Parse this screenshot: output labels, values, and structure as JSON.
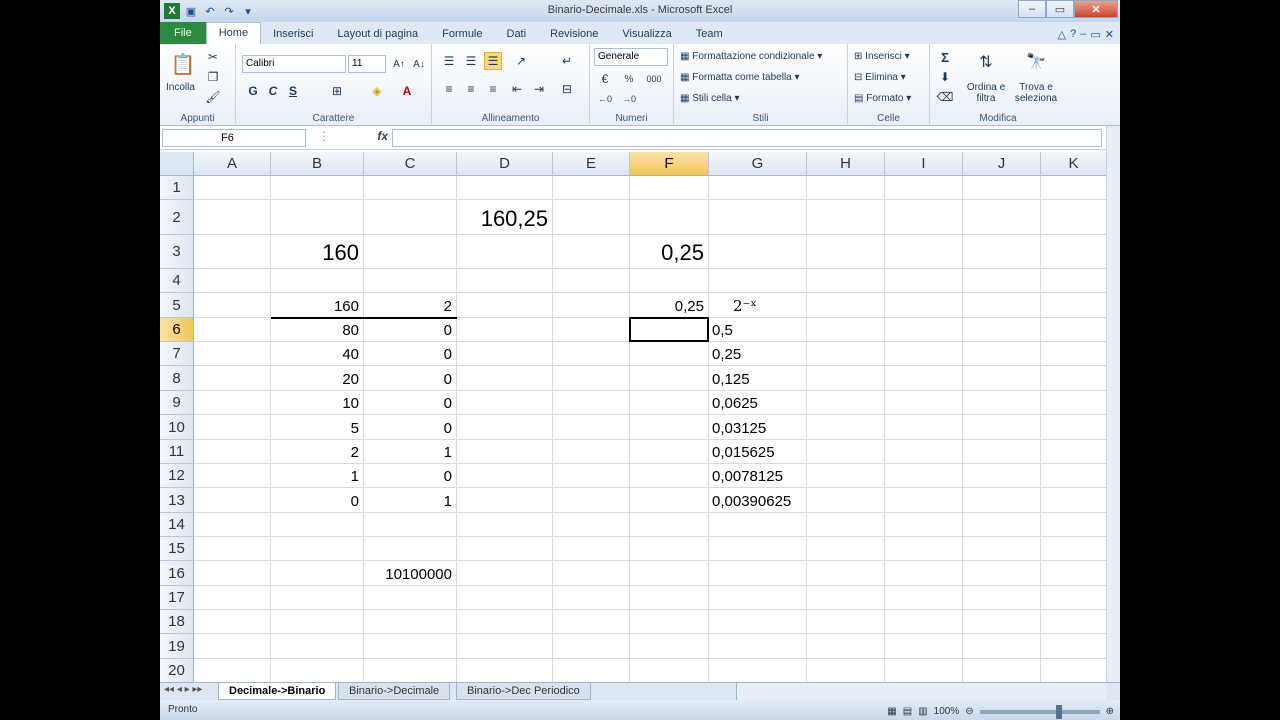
{
  "window": {
    "title": "Binario-Decimale.xls - Microsoft Excel",
    "minimize": "–",
    "restore": "▭",
    "close": "✕"
  },
  "ribbon_tabs": [
    "File",
    "Home",
    "Inserisci",
    "Layout di pagina",
    "Formule",
    "Dati",
    "Revisione",
    "Visualizza",
    "Team"
  ],
  "ribbon": {
    "clipboard": {
      "label": "Appunti",
      "paste": "Incolla"
    },
    "font": {
      "label": "Carattere",
      "name": "Calibri",
      "size": "11",
      "bold": "G",
      "italic": "C",
      "underline": "S",
      "grow": "A↑",
      "shrink": "A↓",
      "color": "A"
    },
    "alignment": {
      "label": "Allineamento"
    },
    "number": {
      "label": "Numeri",
      "format": "Generale",
      "percent": "%",
      "thousands": "000"
    },
    "styles": {
      "label": "Stili",
      "conditional": "Formattazione condizionale",
      "as_table": "Formatta come tabella",
      "cell_styles": "Stili cella"
    },
    "cells": {
      "label": "Celle",
      "insert": "Inserisci",
      "delete": "Elimina",
      "format": "Formato"
    },
    "editing": {
      "label": "Modifica",
      "sum": "Σ",
      "sort": "Ordina e filtra",
      "find": "Trova e seleziona"
    }
  },
  "formula_bar": {
    "name_box": "F6",
    "fx": "fx",
    "value": ""
  },
  "columns": [
    "A",
    "B",
    "C",
    "D",
    "E",
    "F",
    "G",
    "H",
    "I",
    "J",
    "K"
  ],
  "selected_column": "F",
  "selected_row": "6",
  "rows": [
    "1",
    "2",
    "3",
    "4",
    "5",
    "6",
    "7",
    "8",
    "9",
    "10",
    "11",
    "12",
    "13",
    "14",
    "15",
    "16",
    "17",
    "18",
    "19",
    "20"
  ],
  "cells": {
    "D2": "160,25",
    "B3": "160",
    "F3": "0,25",
    "B5": "160",
    "C5": "2",
    "F5": "0,25",
    "G5": "2⁻ˣ",
    "B6": "80",
    "C6": "0",
    "G6": "0,5",
    "B7": "40",
    "C7": "0",
    "G7": "0,25",
    "B8": "20",
    "C8": "0",
    "G8": "0,125",
    "B9": "10",
    "C9": "0",
    "G9": "0,0625",
    "B10": "5",
    "C10": "0",
    "G10": "0,03125",
    "B11": "2",
    "C11": "1",
    "G11": "0,015625",
    "B12": "1",
    "C12": "0",
    "G12": "0,0078125",
    "B13": "0",
    "C13": "1",
    "G13": "0,00390625",
    "C16": "10100000"
  },
  "sheet_tabs": [
    "Decimale->Binario",
    "Binario->Decimale",
    "Binario->Dec Periodico"
  ],
  "active_sheet": "Decimale->Binario",
  "status": {
    "ready": "Pronto",
    "zoom": "100%"
  }
}
